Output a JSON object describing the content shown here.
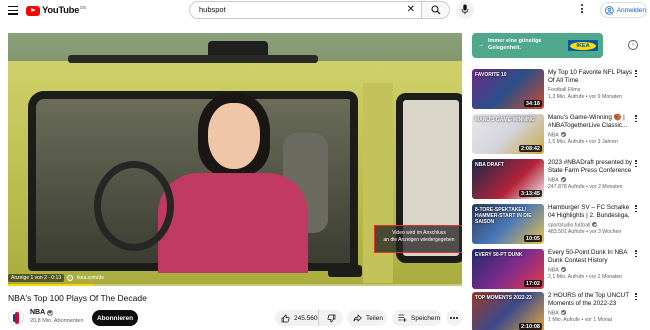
{
  "header": {
    "logo_text": "YouTube",
    "logo_region": "DE",
    "search_value": "hubspot",
    "signin_label": "Anmelden"
  },
  "player": {
    "ad_overlay_line1": "Video wird im Anschluss",
    "ad_overlay_line2": "an die Anzeigen wiedergegeben",
    "ad_counter": "Anzeige 1 von 2 · 0:13",
    "ad_url": "ikea.com/de",
    "progress": 0.19,
    "progress_color": "#fcd600"
  },
  "video": {
    "title": "NBA's Top 100 Plays Of The Decade",
    "channel": "NBA",
    "subscribers": "20,8 Mio. Abonnenten",
    "subscribe_label": "Abonnieren",
    "likes": "245.560",
    "share_label": "Teilen",
    "save_label": "Speichern"
  },
  "sidebar_ad": {
    "line1": "Immer eine günstige",
    "line2": "Gelegenheit.",
    "brand": "IKEA"
  },
  "recommendations": [
    {
      "title": "My Top 10 Favorite NFL Plays Of All Time",
      "channel": "Football Films",
      "meta": "1,3 Mio. Aufrufe • vor 9 Monaten",
      "duration": "34:18",
      "thumb_text": "FAVORITE 10",
      "verified": false
    },
    {
      "title": "Manu's Game-Winning 🏀 | #NBATogetherLive Classic...",
      "channel": "NBA",
      "meta": "1,5 Mio. Aufrufe • vor 3 Jahren",
      "duration": "2:08:42",
      "thumb_text": "MANU'S GAME-WINNING",
      "verified": true
    },
    {
      "title": "2023 #NBADraft presented by State Farm Press Conference",
      "channel": "NBA",
      "meta": "247.878 Aufrufe • vor 2 Monaten",
      "duration": "3:13:45",
      "thumb_text": "NBA DRAFT",
      "verified": true
    },
    {
      "title": "Hamburger SV – FC Schalke 04 Highlights | 2. Bundesliga, 1....",
      "channel": "sportstudio fußball",
      "meta": "483.501 Aufrufe • vor 3 Wochen",
      "duration": "10:05",
      "thumb_text": "8-TORE-SPEKTAKEL! HAMMER-START IN DIE SAISON",
      "verified": true
    },
    {
      "title": "Every 50-Point Dunk In NBA Dunk Contest History (1984-...",
      "channel": "NBA",
      "meta": "2,1 Mio. Aufrufe • vor 2 Monaten",
      "duration": "17:02",
      "thumb_text": "EVERY 50-PT DUNK",
      "verified": true
    },
    {
      "title": "2 HOURS of the Top UNCUT Moments of the 2022-23 NBA...",
      "channel": "NBA",
      "meta": "1 Mio. Aufrufe • vor 1 Monat",
      "duration": "2:10:08",
      "thumb_text": "TOP MOMENTS 2022-23",
      "verified": true
    }
  ]
}
